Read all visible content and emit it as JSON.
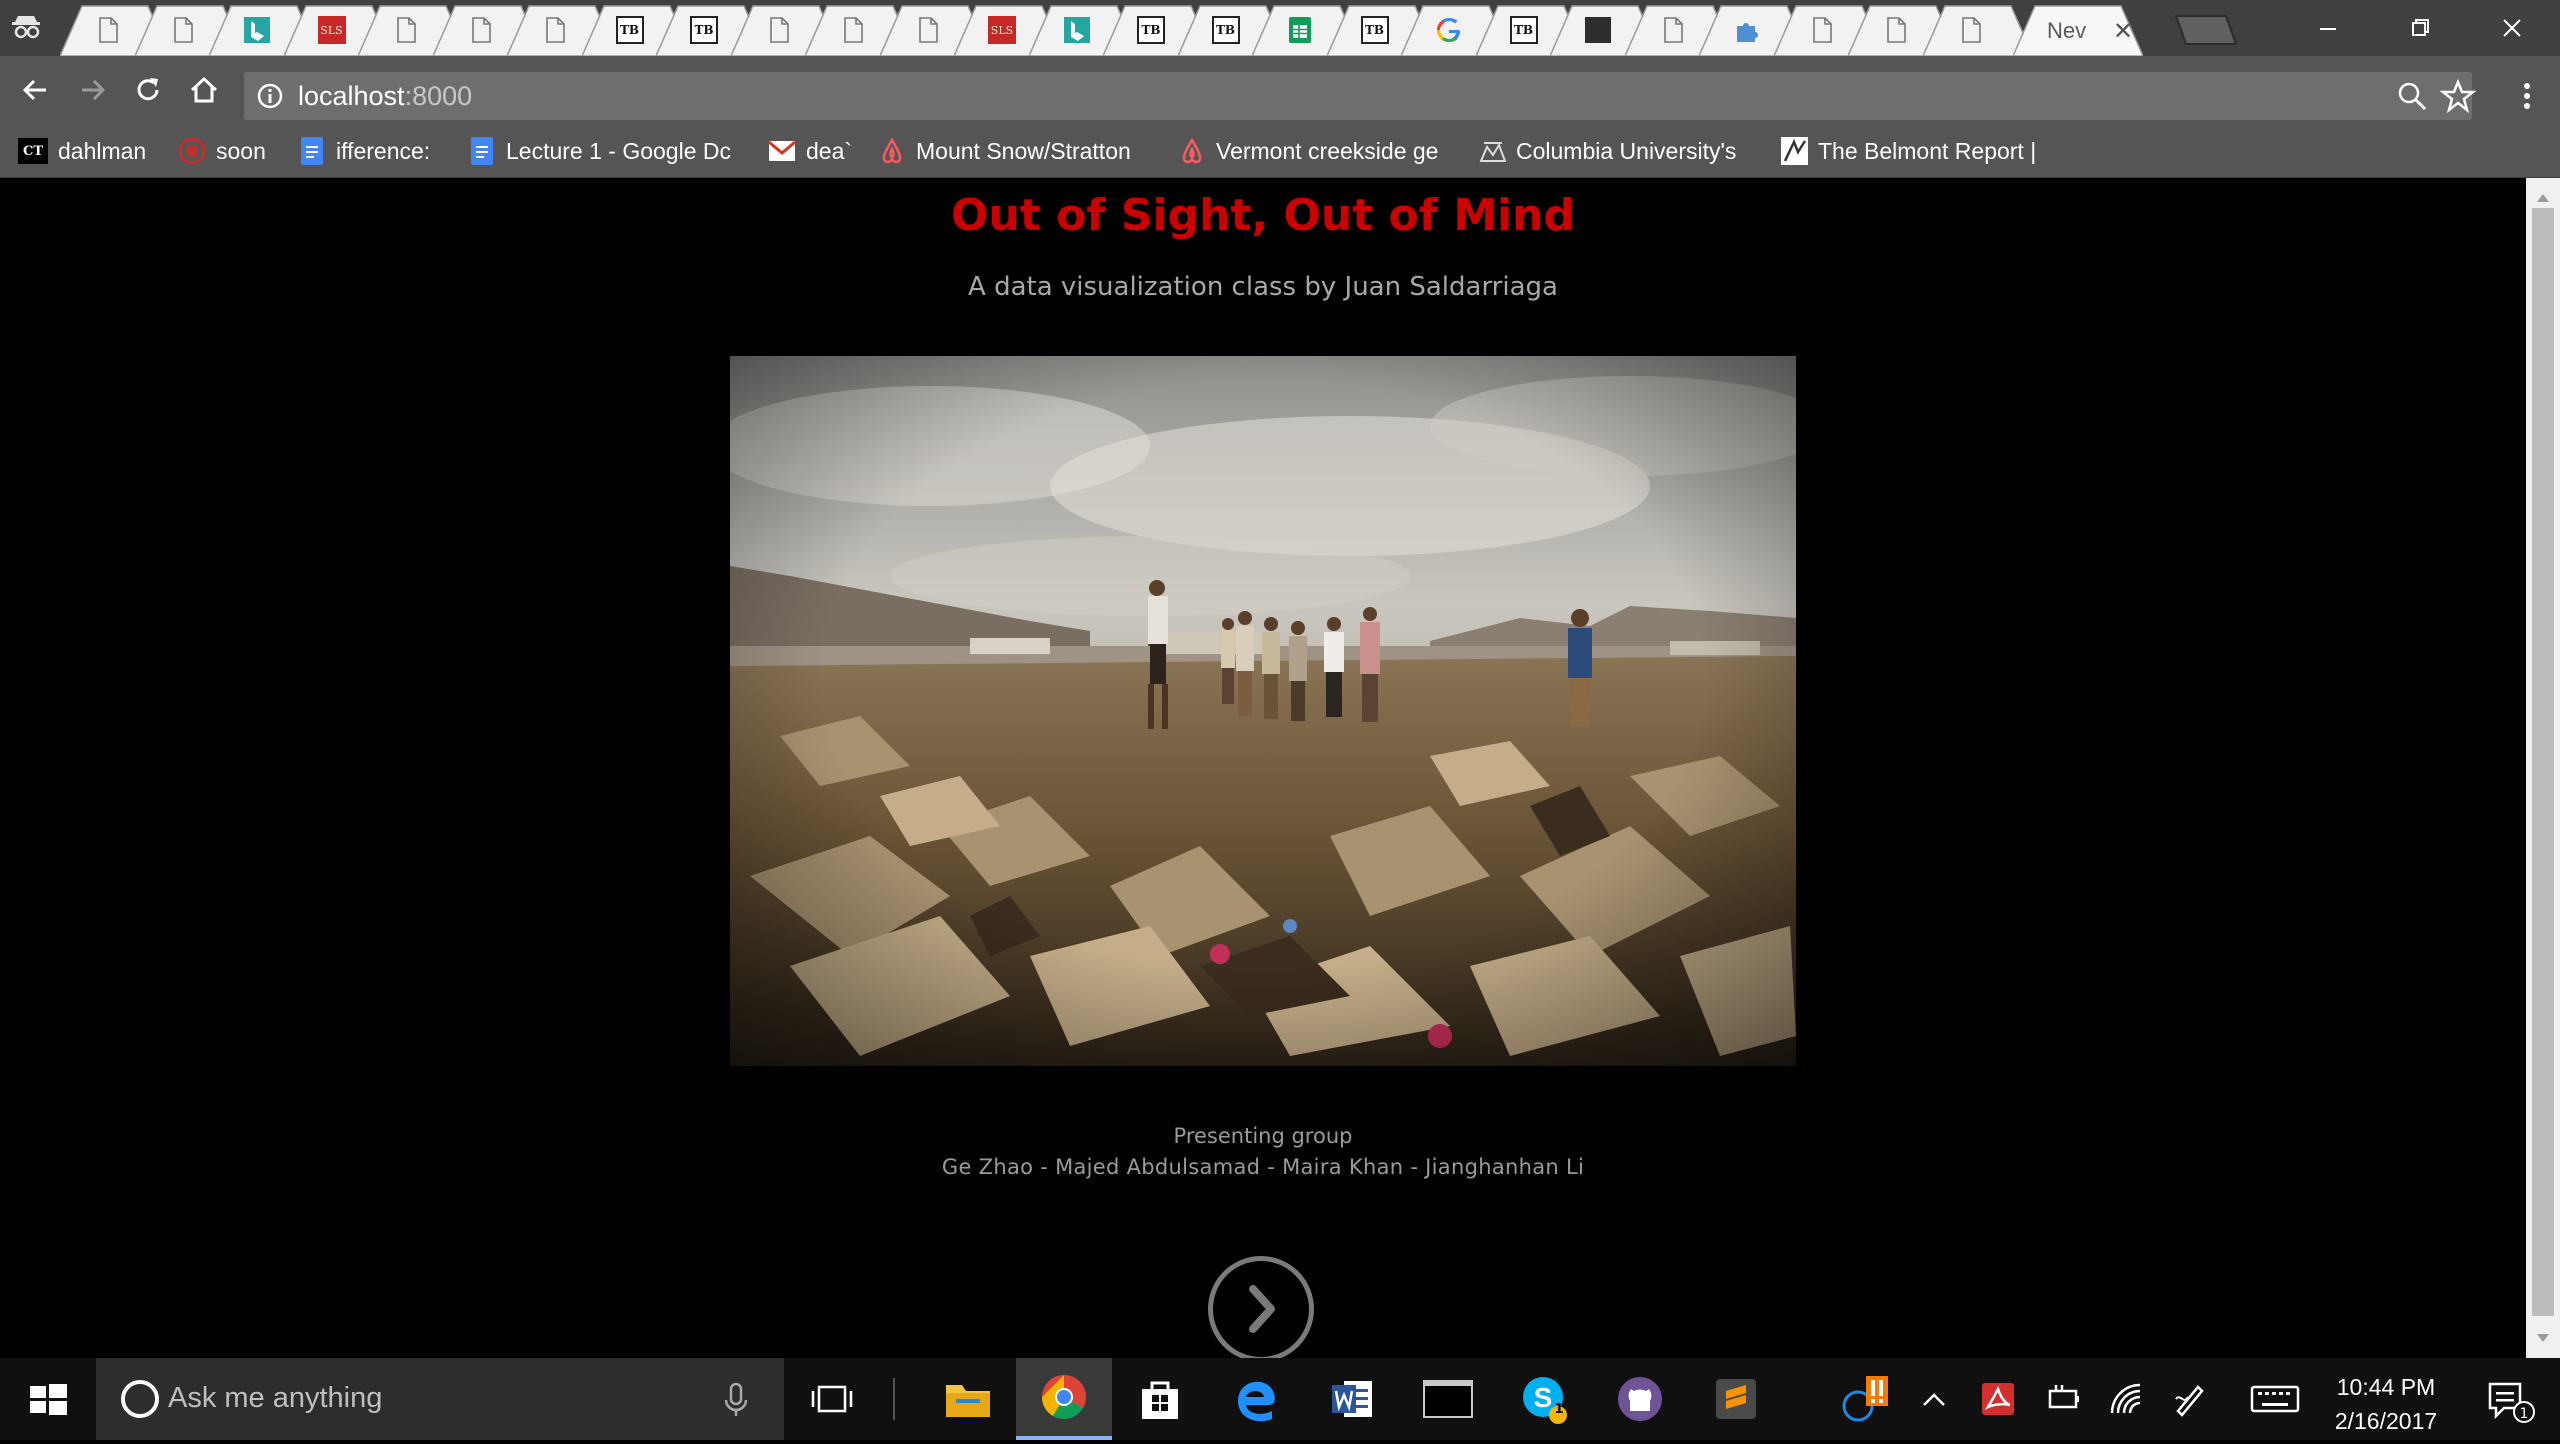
{
  "browser": {
    "tabs": [
      {
        "favicon": "page-icon"
      },
      {
        "favicon": "page-icon"
      },
      {
        "favicon": "bing-icon"
      },
      {
        "favicon": "sls-icon",
        "text": "SLS"
      },
      {
        "favicon": "page-icon"
      },
      {
        "favicon": "page-icon"
      },
      {
        "favicon": "page-icon"
      },
      {
        "favicon": "tb-icon",
        "text": "TB"
      },
      {
        "favicon": "tb-icon",
        "text": "TB"
      },
      {
        "favicon": "page-icon"
      },
      {
        "favicon": "page-icon"
      },
      {
        "favicon": "page-icon"
      },
      {
        "favicon": "sls-icon",
        "text": "SLS"
      },
      {
        "favicon": "bing-icon"
      },
      {
        "favicon": "tb-icon",
        "text": "TB"
      },
      {
        "favicon": "tb-icon",
        "text": "TB"
      },
      {
        "favicon": "sheets-icon"
      },
      {
        "favicon": "tb-icon",
        "text": "TB"
      },
      {
        "favicon": "google-icon"
      },
      {
        "favicon": "tb-icon",
        "text": "TB"
      },
      {
        "favicon": "dark-square-icon"
      },
      {
        "favicon": "page-icon"
      },
      {
        "favicon": "puzzle-icon"
      },
      {
        "favicon": "page-icon"
      },
      {
        "favicon": "page-icon"
      },
      {
        "favicon": "page-icon"
      }
    ],
    "active_tab": {
      "title": "Nev",
      "close_glyph": "✕"
    },
    "address": {
      "host": "localhost",
      "port": ":8000"
    },
    "bookmarks": [
      {
        "label": "dahlman",
        "icon": "ct-icon",
        "icon_text": "CT"
      },
      {
        "label": "soon",
        "icon": "red-circle-icon"
      },
      {
        "label": "ifference:",
        "icon": "docs-icon"
      },
      {
        "label": "Lecture 1 - Google Dc",
        "icon": "docs-icon"
      },
      {
        "label": "dea`",
        "icon": "gmail-icon"
      },
      {
        "label": "Mount Snow/Stratton",
        "icon": "airbnb-icon"
      },
      {
        "label": "Vermont creekside ge",
        "icon": "airbnb-icon"
      },
      {
        "label": "Columbia University's",
        "icon": "columbia-icon"
      },
      {
        "label": "The Belmont Report |",
        "icon": "belmont-icon"
      }
    ]
  },
  "page": {
    "title": "Out of Sight, Out of Mind",
    "subtitle": "A data visualization class by Juan Saldarriaga",
    "caption_heading": "Presenting group",
    "caption_names": "Ge Zhao - Majed Abdulsamad - Maira Khan - Jianghanhan Li",
    "colors": {
      "title": "#cc0000",
      "subtitle": "#a8a8a8",
      "background": "#000000"
    }
  },
  "taskbar": {
    "search_placeholder": "Ask me anything",
    "skype_badge": "1",
    "notification_badge": "1",
    "clock_time": "10:44 PM",
    "clock_date": "2/16/2017"
  }
}
